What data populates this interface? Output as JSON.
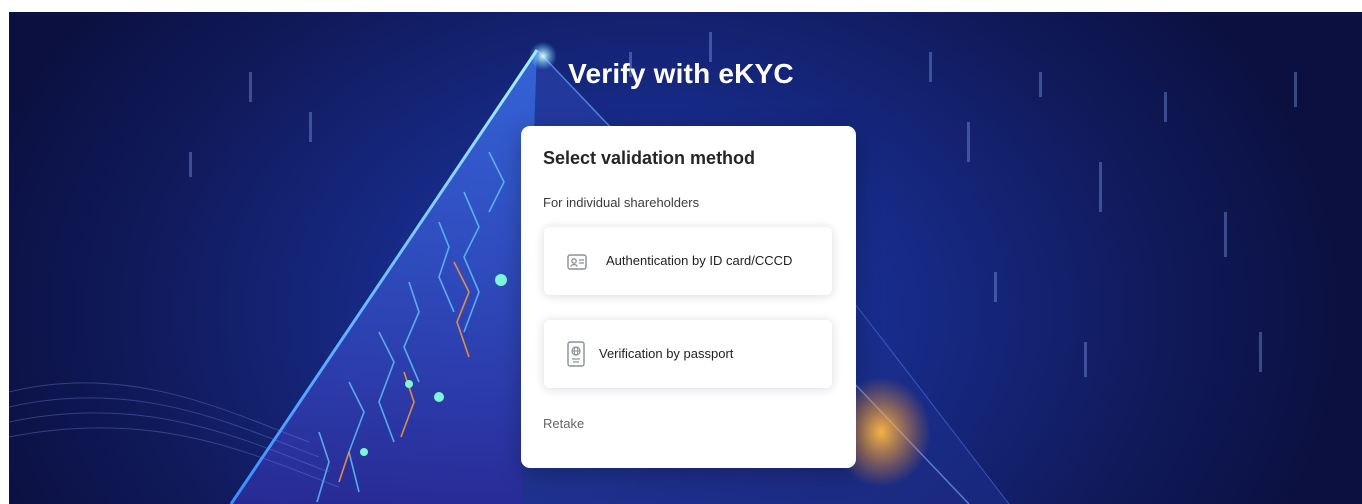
{
  "page": {
    "title": "Verify with eKYC"
  },
  "card": {
    "title": "Select validation method",
    "subtitle": "For individual shareholders",
    "options": [
      {
        "label": "Authentication by ID card/CCCD",
        "icon": "id-card-icon"
      },
      {
        "label": "Verification by passport",
        "icon": "passport-icon"
      }
    ],
    "retake_label": "Retake"
  },
  "colors": {
    "background_dark": "#0b1040",
    "background_mid": "#172b8a",
    "accent_cyan": "#3fd8ff",
    "accent_orange": "#f0a030",
    "card": "#ffffff",
    "icon_gray": "#8a8f99"
  }
}
